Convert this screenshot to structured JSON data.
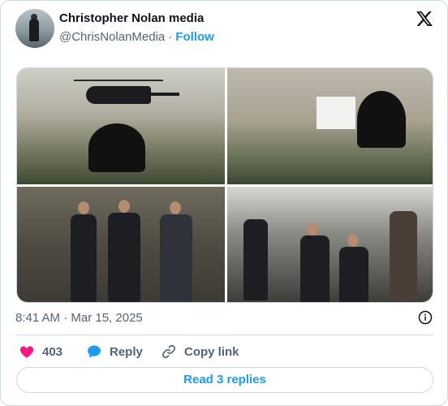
{
  "author": {
    "name": "Christopher Nolan media",
    "handle": "@ChrisNolanMedia",
    "separator": "·",
    "follow_label": "Follow"
  },
  "icons": {
    "brand": "x-logo-icon",
    "info": "info-icon",
    "like": "heart-icon",
    "reply": "reply-bubble-icon",
    "copy": "link-icon"
  },
  "colors": {
    "accent": "#1d9bf0",
    "like": "#f91880",
    "secondary_text": "#536471",
    "border": "#cfd9de"
  },
  "tweet": {
    "timestamp": "8:41 AM · Mar 15, 2025"
  },
  "actions": {
    "likes_count": "403",
    "reply_label": "Reply",
    "copy_label": "Copy link"
  },
  "replies_button": "Read 3 replies"
}
